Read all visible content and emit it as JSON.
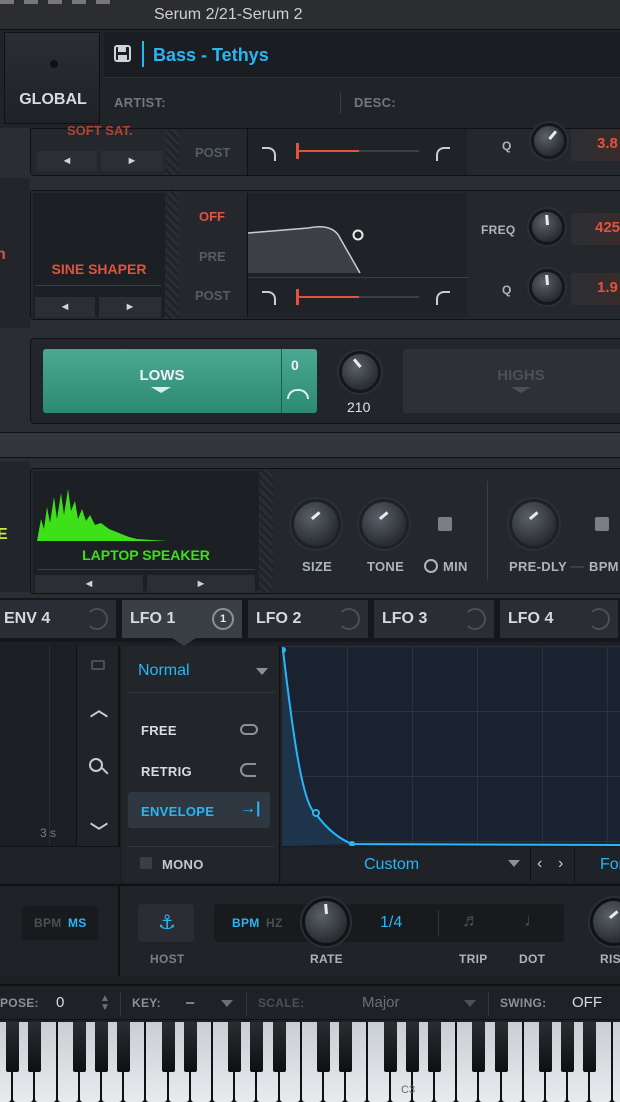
{
  "window": {
    "title": "Serum 2/21-Serum 2"
  },
  "header": {
    "global_label": "GLOBAL",
    "preset_name": "Bass - Tethys",
    "artist_label": "ARTIST:",
    "desc_label": "DESC:"
  },
  "filter_top": {
    "post": "POST",
    "q_label": "Q",
    "q_value": "3.8",
    "label_partial": "SOFT SAT."
  },
  "distortion": {
    "mode": "SINE SHAPER",
    "off": "OFF",
    "pre": "PRE",
    "post": "POST",
    "freq_label": "FREQ",
    "freq_value": "425",
    "q_label": "Q",
    "q_value": "1.9",
    "left_arrow": "◄",
    "right_arrow": "►",
    "edge_letter": "n"
  },
  "multiband": {
    "lows": "LOWS",
    "lows_value": "0",
    "knob_value": "210",
    "highs": "HIGHS"
  },
  "reverb": {
    "mode": "LAPTOP SPEAKER",
    "size": "SIZE",
    "tone": "TONE",
    "min": "MIN",
    "pre_dly": "PRE-DLY",
    "bpm": "BPM",
    "edge_letter": "E"
  },
  "mod_tabs": [
    {
      "label": "ENV 4"
    },
    {
      "label": "LFO 1",
      "badge": "1"
    },
    {
      "label": "LFO 2"
    },
    {
      "label": "LFO 3"
    },
    {
      "label": "LFO 4"
    }
  ],
  "lfo": {
    "mode": "Normal",
    "free": "FREE",
    "retrig": "RETRIG",
    "envelope": "ENVELOPE",
    "mono": "MONO",
    "shape": "Custom",
    "partial_right": "For",
    "time_label": "3 s"
  },
  "rate_bar": {
    "bpm_left": "BPM",
    "ms_left": "MS",
    "host": "HOST",
    "bpm": "BPM",
    "hz": "HZ",
    "rate": "RATE",
    "rate_value": "1/4",
    "trip": "TRIP",
    "dot": "DOT",
    "rise_partial": "RIS"
  },
  "bottom_bar": {
    "transpose_partial": "POSE:",
    "transpose_value": "0",
    "key_label": "KEY:",
    "key_value": "–",
    "scale_label": "SCALE:",
    "scale_value": "Major",
    "swing_label": "SWING:",
    "swing_value": "OFF"
  },
  "keyboard": {
    "c3": "C3"
  },
  "colors": {
    "accent": "#29b6f6",
    "red": "#e2533f",
    "green": "#3ee01a",
    "teal": "#3aa58c"
  }
}
